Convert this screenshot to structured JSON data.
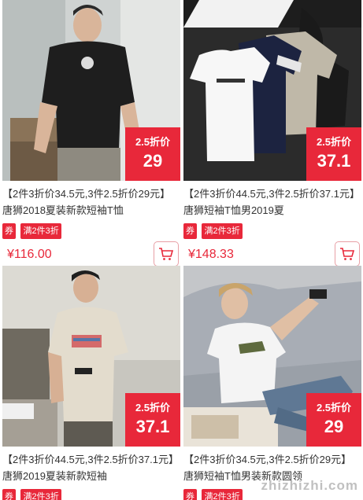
{
  "products": [
    {
      "badge_label": "2.5折价",
      "badge_value": "29",
      "title": "【2件3折价34.5元,3件2.5折价29元】唐狮2018夏装新款短袖T恤",
      "coupon_tag": "券",
      "promo_tag": "满2件3折",
      "price": "¥116.00",
      "image_desc": "man in black t-shirt"
    },
    {
      "badge_label": "2.5折价",
      "badge_value": "37.1",
      "title": "【2件3折价44.5元,3件2.5折价37.1元】唐狮短袖T恤男2019夏",
      "coupon_tag": "券",
      "promo_tag": "满2件3折",
      "price": "¥148.33",
      "image_desc": "four t-shirts laid out"
    },
    {
      "badge_label": "2.5折价",
      "badge_value": "37.1",
      "title": "【2件3折价44.5元,3件2.5折价37.1元】唐狮2019夏装新款短袖",
      "coupon_tag": "券",
      "promo_tag": "满2件3折",
      "price": "",
      "image_desc": "man in beige printed t-shirt"
    },
    {
      "badge_label": "2.5折价",
      "badge_value": "29",
      "title": "【2件3折价34.5元,3件2.5折价29元】唐狮短袖T恤男装新款圆领",
      "coupon_tag": "券",
      "promo_tag": "满2件3折",
      "price": "",
      "image_desc": "man in white printed t-shirt on sofa"
    }
  ],
  "watermark": "zhizhizhi.com",
  "colors": {
    "accent": "#e8283a"
  }
}
